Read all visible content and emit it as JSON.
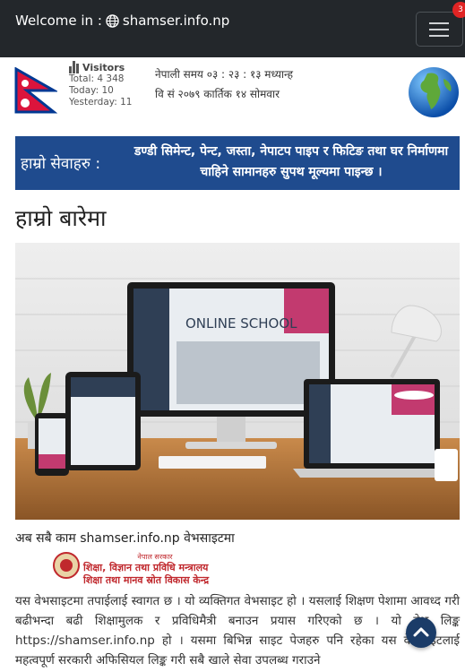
{
  "header": {
    "welcome_label": "Welcome in :",
    "site_name": "shamser.info.np",
    "notification_count": "3"
  },
  "visitors": {
    "title": "Visitors",
    "total": "Total: 4 348",
    "today": "Today: 10",
    "yesterday": "Yesterday: 11"
  },
  "datetime": {
    "time_line": "नेपाली समय ०३ : २३ : १३ मध्यान्ह",
    "date_line": "वि सं २०७९ कार्तिक १४ सोमवार"
  },
  "banner": {
    "left_text": "हाम्रो सेवाहरु :",
    "right_text": "डण्डी सिमेन्ट, पेन्ट, जस्ता, नेपाटप पाइप र फिटिङ तथा घर निर्माणमा चाहिने सामानहरु सुपथ मूल्यमा पाइन्छ ।"
  },
  "about": {
    "heading": "हाम्रो बारेमा",
    "hero_screen_text": "ONLINE SCHOOL",
    "caption": "अब सबै काम shamser.info.np वेभसाइटमा",
    "logo_line1": "नेपाल सरकार",
    "logo_line2": "शिक्षा, विज्ञान तथा प्रविधि मन्त्रालय",
    "logo_line3": "शिक्षा तथा मानव स्रोत विकास केन्द्र",
    "paragraph": "यस वेभसाइटमा तपाईलाई स्वागत छ । यो व्यक्तिगत वेभसाइट हो । यसलाई शिक्षण पेशामा आवध्द गरी बढीभन्दा बढी शिक्षामुलक र प्रविधिमैत्री बनाउन प्रयास गरिएको छ । यो वेभ लिङ्क https://shamser.info.np हो । यसमा बिभिन्न साइट पेजहरु पनि रहेका यस वेभसाइटलाई महत्वपूर्ण सरकारी अफिसियल लिङ्क गरी सबै खाले सेवा उपलब्ध गराउने"
  },
  "colors": {
    "topbar": "#23272b",
    "banner": "#1f4b8e",
    "accent_red": "#c0282d"
  }
}
